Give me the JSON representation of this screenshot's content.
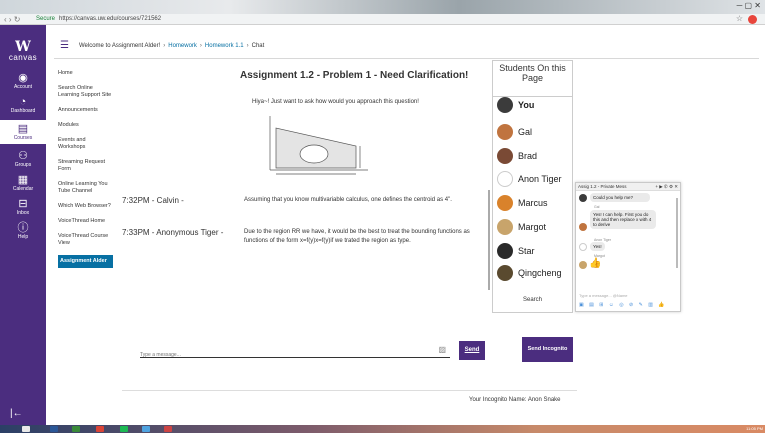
{
  "browser": {
    "secure_label": "Secure",
    "url": "https://canvas.uw.edu/courses/721562"
  },
  "global_nav": {
    "logo_letter": "W",
    "logo_text": "canvas",
    "items": [
      {
        "label": "Account",
        "icon": "account-icon"
      },
      {
        "label": "Dashboard",
        "icon": "dashboard-icon"
      },
      {
        "label": "Courses",
        "icon": "courses-icon"
      },
      {
        "label": "Groups",
        "icon": "groups-icon"
      },
      {
        "label": "Calendar",
        "icon": "calendar-icon"
      },
      {
        "label": "Inbox",
        "icon": "inbox-icon"
      },
      {
        "label": "Help",
        "icon": "help-icon"
      }
    ]
  },
  "breadcrumb": {
    "course": "Welcome to Assignment Alder!",
    "section": "Homework",
    "item": "Homework 1.1",
    "current": "Chat"
  },
  "course_nav": [
    "Home",
    "Search Online Learning Support Site",
    "Announcements",
    "Modules",
    "Events and Workshops",
    "Streaming Request Form",
    "Online Learning You Tube Channel",
    "Which Web Browser?",
    "VoiceThread Home",
    "VoiceThread Course View",
    "Assignment Alder"
  ],
  "main": {
    "title": "Assignment 1.2 - Problem 1 - Need Clarification!",
    "question": "Hiya~! Just want to ask how would you approach this question!",
    "messages": [
      {
        "who": "7:32PM - Calvin -",
        "text": "Assuming that you know multivariable calculus, one defines the centroid as 4\"."
      },
      {
        "who": "7:33PM - Anonymous Tiger -",
        "text": "Due to the region RR we have, it would be the best to treat the bounding functions as functions of the form x=f(y)x=f(y)if we trated the region as type."
      }
    ]
  },
  "students": {
    "header": "Students On this Page",
    "list": [
      {
        "name": "You",
        "color": "#3b3b3b"
      },
      {
        "name": "Gal",
        "color": "#c0743f"
      },
      {
        "name": "Brad",
        "color": "#7a4a35"
      },
      {
        "name": "Anon Tiger",
        "color": "#ffffff"
      },
      {
        "name": "Marcus",
        "color": "#d9822b"
      },
      {
        "name": "Margot",
        "color": "#c8a46b"
      },
      {
        "name": "Star",
        "color": "#2a2a2a"
      },
      {
        "name": "Qingcheng",
        "color": "#5a4a2f"
      }
    ],
    "search_label": "Search"
  },
  "chat_popup": {
    "title": "Assig 1.2 - Private Mess",
    "bubble1": "Could you help me?",
    "name2": "Gal",
    "bubble2": "Yes! I can help. First you do this and then replace x with 4 to derive",
    "name3": "Anon Tiger",
    "bubble3": "Yes!",
    "name4": "Margot",
    "input_placeholder": "Type a message... @Name"
  },
  "composer": {
    "placeholder": "Type a message...",
    "send_label": "Send",
    "incognito_label": "Send Incognito"
  },
  "incognito_name": "Your Incognito Name: Anon Snake",
  "taskbar": {
    "clock": "11:05 PM"
  },
  "colors": {
    "canvas_purple": "#4b2d7f",
    "link_blue": "#0770a3"
  }
}
